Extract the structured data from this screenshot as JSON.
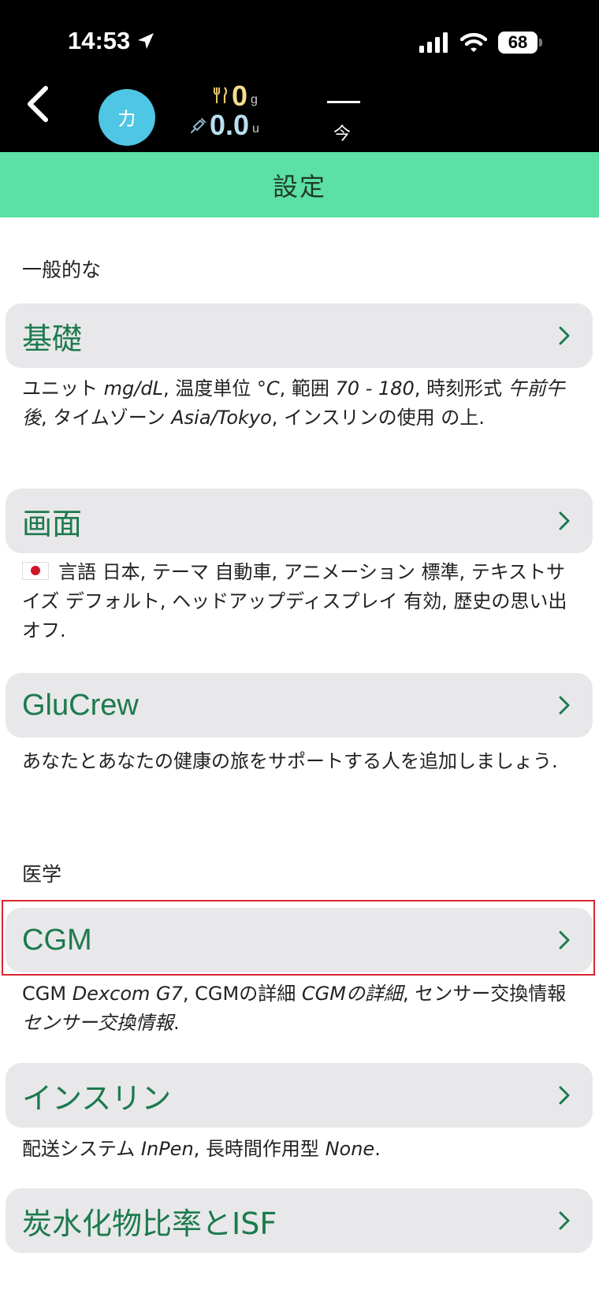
{
  "status_bar": {
    "time": "14:53",
    "battery": "68"
  },
  "top_bar": {
    "avatar_initial": "カ",
    "carb_value": "0",
    "carb_unit": "g",
    "insulin_value": "0.0",
    "insulin_unit": "u",
    "now_label": "今"
  },
  "header": {
    "title": "設定"
  },
  "sections": {
    "general": {
      "title": "一般的な"
    },
    "medical": {
      "title": "医学"
    }
  },
  "rows": {
    "basics": {
      "label": "基礎",
      "desc": {
        "unit_label": "ユニット",
        "unit_value": "mg/dL",
        "temp_label": "温度単位",
        "temp_value": "°C",
        "range_label": "範囲",
        "range_value": "70 - 180",
        "time_format_label": "時刻形式",
        "time_format_value": "午前午後",
        "timezone_label": "タイムゾーン",
        "timezone_value": "Asia/Tokyo",
        "insulin_use_label": "インスリンの使用",
        "insulin_use_value": "の上"
      }
    },
    "display": {
      "label": "画面",
      "desc": {
        "language_label": "言語",
        "language_value": "日本",
        "theme_label": "テーマ",
        "theme_value": "自動車",
        "animation_label": "アニメーション",
        "animation_value": "標準",
        "text_size_label": "テキストサイズ",
        "text_size_value": "デフォルト",
        "hud_label": "ヘッドアップディスプレイ",
        "hud_value": "有効",
        "memories_label": "歴史の思い出",
        "memories_value": "オフ"
      }
    },
    "glucrew": {
      "label": "GluCrew",
      "desc": "あなたとあなたの健康の旅をサポートする人を追加しましょう."
    },
    "cgm": {
      "label": "CGM",
      "desc": {
        "cgm_label": "CGM",
        "cgm_value": "Dexcom G7",
        "detail_label": "CGMの詳細",
        "detail_value": "CGMの詳細",
        "sensor_label": "センサー交換情報",
        "sensor_value": "センサー交換情報"
      }
    },
    "insulin": {
      "label": "インスリン",
      "desc": {
        "delivery_label": "配送システム",
        "delivery_value": "InPen",
        "long_acting_label": "長時間作用型",
        "long_acting_value": "None"
      }
    },
    "carb_ratio": {
      "label": "炭水化物比率とISF"
    }
  },
  "colors": {
    "header_green": "#5ce0a3",
    "row_label_green": "#1d7a4d",
    "avatar_blue": "#4fc6e3",
    "highlight_red": "#d9252f"
  }
}
